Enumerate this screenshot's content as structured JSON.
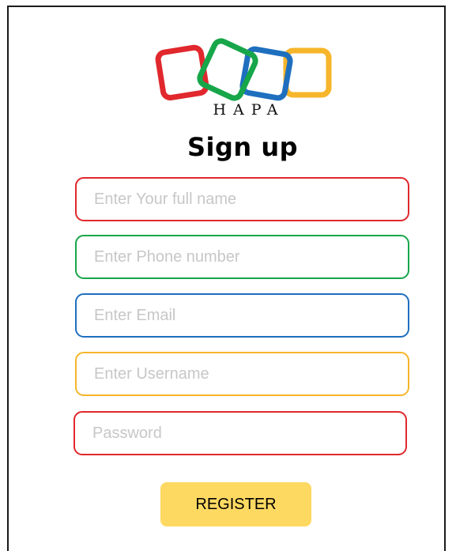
{
  "brand": {
    "name": "HAPA",
    "colors": [
      "#e0282d",
      "#17a64a",
      "#1f6fbf",
      "#f6b52a"
    ]
  },
  "page": {
    "title": "Sign up"
  },
  "form": {
    "full_name_placeholder": "Enter Your full name",
    "phone_placeholder": "Enter Phone number",
    "email_placeholder": "Enter Email",
    "username_placeholder": "Enter Username",
    "password_placeholder": "Password",
    "register_label": "REGISTER"
  }
}
